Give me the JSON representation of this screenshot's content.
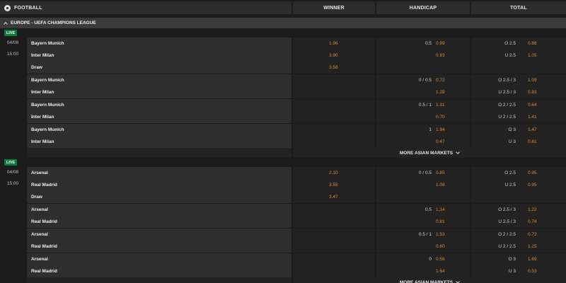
{
  "header": {
    "sport": "FOOTBALL",
    "col_winner": "WINNER",
    "col_handicap": "HANDICAP",
    "col_total": "TOTAL"
  },
  "league": {
    "title": "EUROPE - UEFA CHAMPIONS LEAGUE"
  },
  "colors": {
    "odds": "#e08a2e",
    "live": "#0f7a3c"
  },
  "matches": [
    {
      "live": "LIVE",
      "date": "04/08",
      "time": "15:00",
      "more": "MORE ASIAN MARKETS",
      "groups": [
        {
          "rows": [
            {
              "team": "Bayern Munich",
              "win": "1.96",
              "hc_line": "0.5",
              "hc_odd": "0.99",
              "tot_line": "O 2.5",
              "tot_odd": "0.86"
            },
            {
              "team": "Inter Milan",
              "win": "3.90",
              "hc_line": "",
              "hc_odd": "0.93",
              "tot_line": "U 2.5",
              "tot_odd": "1.05"
            },
            {
              "team": "Draw",
              "win": "3.58",
              "hc_line": "",
              "hc_odd": "",
              "tot_line": "",
              "tot_odd": ""
            }
          ]
        },
        {
          "rows": [
            {
              "team": "Bayern Munich",
              "win": "",
              "hc_line": "0 / 0.5",
              "hc_odd": "0.72",
              "tot_line": "O 2.5 / 3",
              "tot_odd": "1.09"
            },
            {
              "team": "Inter Milan",
              "win": "",
              "hc_line": "",
              "hc_odd": "1.28",
              "tot_line": "U 2.5 / 3",
              "tot_odd": "0.83"
            }
          ]
        },
        {
          "rows": [
            {
              "team": "Bayern Munich",
              "win": "",
              "hc_line": "0.5 / 1",
              "hc_odd": "1.31",
              "tot_line": "O 2 / 2.5",
              "tot_odd": "0.64"
            },
            {
              "team": "Inter Milan",
              "win": "",
              "hc_line": "",
              "hc_odd": "0.70",
              "tot_line": "U 2 / 2.5",
              "tot_odd": "1.41"
            }
          ]
        },
        {
          "rows": [
            {
              "team": "Bayern Munich",
              "win": "",
              "hc_line": "1",
              "hc_odd": "1.94",
              "tot_line": "O 3",
              "tot_odd": "1.47"
            },
            {
              "team": "Inter Milan",
              "win": "",
              "hc_line": "",
              "hc_odd": "0.47",
              "tot_line": "U 3",
              "tot_odd": "0.61"
            }
          ]
        }
      ]
    },
    {
      "live": "LIVE",
      "date": "04/08",
      "time": "15:00",
      "more": "MORE ASIAN MARKETS",
      "groups": [
        {
          "rows": [
            {
              "team": "Arsenal",
              "win": "2.10",
              "hc_line": "0 / 0.5",
              "hc_odd": "0.85",
              "tot_line": "O 2.5",
              "tot_odd": "0.95"
            },
            {
              "team": "Real Madrid",
              "win": "3.55",
              "hc_line": "",
              "hc_odd": "1.08",
              "tot_line": "U 2.5",
              "tot_odd": "0.95"
            },
            {
              "team": "Draw",
              "win": "3.47",
              "hc_line": "",
              "hc_odd": "",
              "tot_line": "",
              "tot_odd": ""
            }
          ]
        },
        {
          "rows": [
            {
              "team": "Arsenal",
              "win": "",
              "hc_line": "0.5",
              "hc_odd": "1.14",
              "tot_line": "O 2.5 / 3",
              "tot_odd": "1.22"
            },
            {
              "team": "Real Madrid",
              "win": "",
              "hc_line": "",
              "hc_odd": "0.81",
              "tot_line": "U 2.5 / 3",
              "tot_odd": "0.74"
            }
          ]
        },
        {
          "rows": [
            {
              "team": "Arsenal",
              "win": "",
              "hc_line": "0.5 / 1",
              "hc_odd": "1.53",
              "tot_line": "O 2 / 2.5",
              "tot_odd": "0.72"
            },
            {
              "team": "Real Madrid",
              "win": "",
              "hc_line": "",
              "hc_odd": "0.60",
              "tot_line": "U 2 / 2.5",
              "tot_odd": "1.25"
            }
          ]
        },
        {
          "rows": [
            {
              "team": "Arsenal",
              "win": "",
              "hc_line": "0",
              "hc_odd": "0.56",
              "tot_line": "O 3",
              "tot_odd": "1.69"
            },
            {
              "team": "Real Madrid",
              "win": "",
              "hc_line": "",
              "hc_odd": "1.64",
              "tot_line": "U 3",
              "tot_odd": "0.53"
            }
          ]
        }
      ]
    }
  ]
}
